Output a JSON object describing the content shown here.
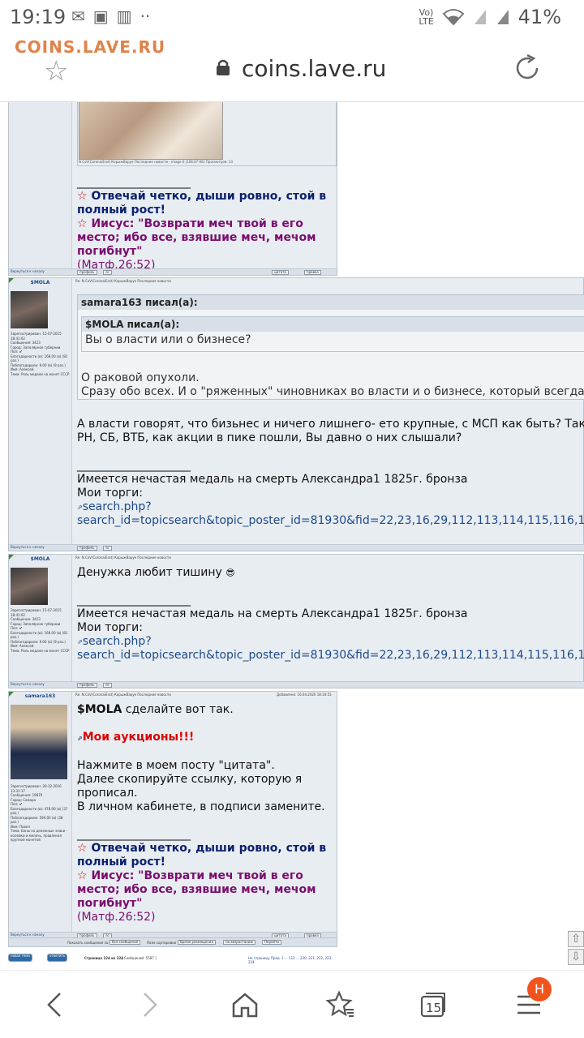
{
  "status": {
    "time": "19:19",
    "battery": "41%",
    "volte_top": "Vo)",
    "volte_bottom": "LTE"
  },
  "browser": {
    "site_label": "COINS.LAVE.RU",
    "url": "coins.lave.ru",
    "tabs_count": "15",
    "profile_initial": "H"
  },
  "post0": {
    "image_caption": "N.CoV(Corona/Erot) КорыжВаруе Последние новости - image 6 (108.67 КБ) Просмотров: 13",
    "sig_line": "____________________",
    "sig1": "Отвечай четко, дыши ровно, стой в полный рост!",
    "sig2": "Иисус: \"Возврати меч твой в его место; ибо все, взявшие меч, мечом погибнут\"",
    "sig3": "(Матф.26:52)",
    "footer_top": "Вернуться к началу",
    "btn_profile": "профиль",
    "btn_pm": "лс",
    "btn_quote": "цитата",
    "btn_edit": "правка"
  },
  "post1": {
    "nick": "$MOLA",
    "header": "Re: N.CoV(Corona/Erot) КорыжВаруе Последние новости",
    "meta": [
      "Зарегистрирован: 15-07-2015 18:41:02",
      "Сообщения: 3423",
      "Город: Заполярное губернии",
      "Пол: ♂",
      "Благодарности (в): 168.00 (в) (81 раз.)",
      "Поблагодарили: 9.00 (в) (9 раз.)",
      "Имя: Алексей",
      "Тема: Роль медали на монет СССР"
    ],
    "quote_outer_header": "samara163 писал(а):",
    "quote_inner_header": "$MOLA писал(а):",
    "quote_inner_text": "Вы о власти или о бизнесе?",
    "quote_outer_text1": "О раковой опухоли.",
    "quote_outer_text2": "Сразу обо всех. И о \"ряженных\" чиновниках во власти и о бизнесе, который всегда грил \"эт",
    "text1": "А власти говорят, что бизьнес и ничего лишнего- ето крупные, с МСП как быть? Так сказать",
    "text2": "РН, СБ, ВТБ, как акции в пике пошли, Вы давно о них слышали?",
    "sig_line": "____________________",
    "sig_a": "Имеется нечастая медаль на смерть Александра1 1825г. бронза",
    "sig_b": "Мои торги:",
    "link1": "search.php?",
    "link2": "search_id=topicsearch&topic_poster_id=81930&fid=22,23,16,29,112,113,114,115,116,118,119,120",
    "footer_top": "Вернуться к началу",
    "btn_profile": "профиль",
    "btn_pm": "лс"
  },
  "post2": {
    "nick": "$MOLA",
    "header": "Re: N.CoV(Corona/Erot) КорыжВаруе Последние новости",
    "text1": "Денужка любит тишину",
    "emoji": "😎",
    "sig_line": "____________________",
    "sig_a": "Имеется нечастая медаль на смерть Александра1 1825г. бронза",
    "sig_b": "Мои торги:",
    "link1": "search.php?",
    "link2": "search_id=topicsearch&topic_poster_id=81930&fid=22,23,16,29,112,113,114,115,116,118,119,120",
    "footer_top": "Вернуться к началу",
    "btn_profile": "профиль",
    "btn_pm": "лс"
  },
  "post3": {
    "nick": "samara163",
    "header": "Re: N.CoV(Corona/Erot) КорыжВаруе Последние новости",
    "added": "Добавлено: 16.04.2020 18:16:55",
    "meta": [
      "Зарегистрирован: 30-12-2016 13:31:17",
      "Сообщения: 19870",
      "Город: Самара",
      "Пол: ♂",
      "Благодарности (в): 478.00 (в) (37 раз.)",
      "Поблагодарили: 590.00 (в) (38 раз.)",
      "Имя: Павел",
      "Тема: Боны на денежные знаки - копейки и мелочь, правленая крупной монетой"
    ],
    "addr": "$MOLA",
    "text_after_addr": "сделайте вот так.",
    "auctions": "Мои аукционы!!!",
    "text1": "Нажмите в моем посту \"цитата\".",
    "text2": "Далее скопируйте ссылку, которую я",
    "text3": "прописал.",
    "text4": "В личном кабинете, в подписи замените.",
    "sig_line": "____________________",
    "sig1": "Отвечай четко, дыши ровно, стой в полный рост!",
    "sig2": "Иисус: \"Возврати меч твой в его место; ибо все, взявшие меч, мечом погибнут\"",
    "sig3": "(Матф.26:52)",
    "footer_top": "Вернуться к началу",
    "btn_profile": "профиль",
    "btn_pm": "лс",
    "btn_quote": "цитата",
    "btn_edit": "правка"
  },
  "bottom": {
    "show_label": "Показать сообщения за:",
    "show_value": "Все сообщения",
    "sort_label": "Поле сортировки",
    "sort_value": "Время размещения",
    "order_value": "по возрастанию",
    "go": "Перейти",
    "new_topic": "новая тема",
    "reply": "ответить",
    "pages": "Страница 224 из 224",
    "count": "[ Сообщений: 5587 ]",
    "pages_nav": "На страницу Пред. 1 ... 112 ... 220, 221, 222, 223, 224"
  }
}
